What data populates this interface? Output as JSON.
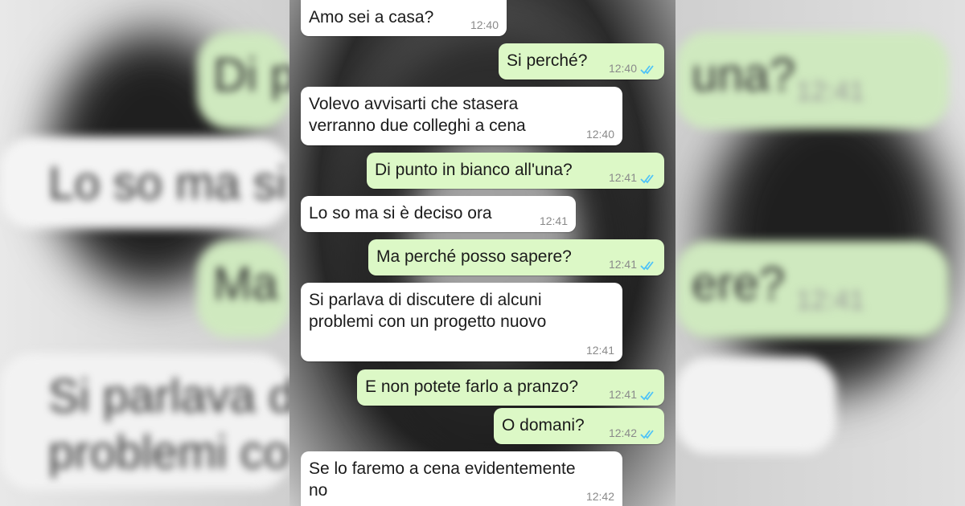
{
  "colors": {
    "incoming_bubble": "#ffffff",
    "outgoing_bubble": "#dcf8c6",
    "read_ticks": "#4fc3f7"
  },
  "backdrop": {
    "left_lines": [
      "Lo so ma si",
      "Si parlava d",
      "problemi co"
    ],
    "right_lines": [
      "Di p",
      "una?",
      "ere?",
      "Ma"
    ],
    "left_times": [],
    "right_times": [
      "12:41",
      "12:41"
    ]
  },
  "messages": [
    {
      "direction": "in",
      "text": "Amo sei a casa?",
      "time": "12:40"
    },
    {
      "direction": "out",
      "text": "Si perché?",
      "time": "12:40",
      "status": "read-ticks-icon"
    },
    {
      "direction": "in",
      "text": "Volevo avvisarti che stasera verranno due colleghi a cena",
      "time": "12:40"
    },
    {
      "direction": "out",
      "text": "Di punto in bianco all'una?",
      "time": "12:41",
      "status": "read-ticks-icon"
    },
    {
      "direction": "in",
      "text": "Lo so ma si è deciso ora",
      "time": "12:41"
    },
    {
      "direction": "out",
      "text": "Ma perché posso sapere?",
      "time": "12:41",
      "status": "read-ticks-icon"
    },
    {
      "direction": "in",
      "text": "Si parlava di discutere di alcuni problemi con un progetto nuovo",
      "time": "12:41"
    },
    {
      "direction": "out",
      "text": "E non potete farlo a pranzo?",
      "time": "12:41",
      "status": "read-ticks-icon"
    },
    {
      "direction": "out",
      "text": "O domani?",
      "time": "12:42",
      "status": "read-ticks-icon"
    },
    {
      "direction": "in",
      "text": "Se lo faremo a cena evidentemente no",
      "time": "12:42"
    }
  ]
}
